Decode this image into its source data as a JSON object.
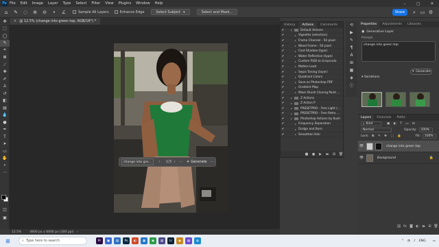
{
  "menubar": {
    "items": [
      "File",
      "Edit",
      "Image",
      "Layer",
      "Type",
      "Select",
      "Filter",
      "View",
      "Plugins",
      "Window",
      "Help"
    ],
    "logo": "Ps"
  },
  "options_bar": {
    "sample_all_layers": "Sample All Layers",
    "enhance_edge": "Enhance Edge",
    "select_subject": "Select Subject",
    "select_and_mask": "Select and Mask...",
    "share": "Share"
  },
  "document": {
    "tab_title": "@ 12.5% (change into green top, RGB/16*) *",
    "status_zoom": "12.5%",
    "status_info": "4800 px x 6000 px (300 ppi)"
  },
  "context_bar": {
    "prompt": "change into gre...",
    "counter": "1/3",
    "generate": "Generate"
  },
  "actions_panel": {
    "tabs": [
      "History",
      "Actions",
      "Comments"
    ],
    "active_tab": "Actions",
    "rows": [
      {
        "label": "Default Actions",
        "check": "✔",
        "box": "",
        "folder": true,
        "indent": 0
      },
      {
        "label": "Vignette (selection)",
        "check": "✔",
        "box": "",
        "folder": false,
        "indent": 1
      },
      {
        "label": "Frame Channel - 50 pixel",
        "check": "✔",
        "box": "",
        "folder": false,
        "indent": 1
      },
      {
        "label": "Wood Frame - 50 pixel",
        "check": "✔",
        "box": "",
        "folder": false,
        "indent": 1
      },
      {
        "label": "Cast Shadow (type)",
        "check": "✔",
        "box": "",
        "folder": false,
        "indent": 1
      },
      {
        "label": "Water Reflection (type)",
        "check": "✔",
        "box": "",
        "folder": false,
        "indent": 1
      },
      {
        "label": "Custom RGB to Grayscale",
        "check": "✔",
        "box": "",
        "folder": false,
        "indent": 1
      },
      {
        "label": "Molten Lead",
        "check": "✔",
        "box": "",
        "folder": false,
        "indent": 1
      },
      {
        "label": "Sepia Toning (layer)",
        "check": "✔",
        "box": "",
        "folder": false,
        "indent": 1
      },
      {
        "label": "Quadrant Colors",
        "check": "✔",
        "box": "",
        "folder": false,
        "indent": 1
      },
      {
        "label": "Save as Photoshop PDF",
        "check": "✔",
        "box": "",
        "folder": false,
        "indent": 1
      },
      {
        "label": "Gradient Map",
        "check": "✔",
        "box": "",
        "folder": false,
        "indent": 1
      },
      {
        "label": "Mixer Brush Cloning Paint ...",
        "check": "✔",
        "box": "",
        "folder": false,
        "indent": 1
      },
      {
        "label": "Z Actions",
        "check": "✔",
        "box": "",
        "folder": true,
        "indent": 0
      },
      {
        "label": "Z Action P",
        "check": "✔",
        "box": "",
        "folder": true,
        "indent": 0
      },
      {
        "label": "PRESETPRO - Free Light (...",
        "check": "✔",
        "box": "",
        "folder": true,
        "indent": 0
      },
      {
        "label": "PRESETPRO - Free Retro ...",
        "check": "✔",
        "box": "",
        "folder": true,
        "indent": 0
      },
      {
        "label": "Photoshop Actions by Kush",
        "check": "✔",
        "box": "",
        "folder": true,
        "indent": 0
      },
      {
        "label": "Frequency Separation",
        "check": "✔",
        "box": "",
        "folder": false,
        "indent": 1
      },
      {
        "label": "Dodge and Burn",
        "check": "✔",
        "box": "",
        "folder": false,
        "indent": 1
      },
      {
        "label": "Smoothen Hair",
        "check": "✔",
        "box": "",
        "folder": false,
        "indent": 1
      }
    ]
  },
  "properties_panel": {
    "tabs": [
      "Properties",
      "Adjustments",
      "Libraries"
    ],
    "active_tab": "Properties",
    "layer_type": "Generative Layer",
    "prompt_label": "Prompt:",
    "prompt_value": "change into green top",
    "generate": "Generate",
    "variations": "Variations"
  },
  "layers_panel": {
    "tabs": [
      "Layers",
      "Channels",
      "Paths"
    ],
    "active_tab": "Layers",
    "kind": "Kind",
    "blend_mode": "Normal",
    "opacity_label": "Opacity:",
    "opacity_value": "100%",
    "lock_label": "Lock:",
    "fill_label": "Fill:",
    "fill_value": "100%",
    "layers": [
      {
        "name": "change into green top",
        "selected": true
      },
      {
        "name": "Background",
        "selected": false
      }
    ]
  },
  "taskbar": {
    "search_placeholder": "Type here to search",
    "lang": "ENG",
    "time": "",
    "apps": [
      {
        "label": "Pr",
        "color": "#2a0b45"
      },
      {
        "label": "▣",
        "color": "#3b6bd1"
      },
      {
        "label": "▤",
        "color": "#2f6fc2"
      },
      {
        "label": "Ps",
        "color": "#0c2a44"
      },
      {
        "label": "◐",
        "color": "#d04a2a"
      },
      {
        "label": "▦",
        "color": "#2276c9"
      },
      {
        "label": "◉",
        "color": "#2e9b4a"
      },
      {
        "label": "▥",
        "color": "#4a4a8a"
      },
      {
        "label": "Lr",
        "color": "#0c2235"
      },
      {
        "label": "◆",
        "color": "#c98a22"
      },
      {
        "label": "▧",
        "color": "#6a4ac9"
      },
      {
        "label": "◍",
        "color": "#1b8bd0"
      }
    ]
  },
  "colors": {
    "accent": "#1473e6",
    "panel": "#383838",
    "green_top": "#1f7a3a"
  }
}
